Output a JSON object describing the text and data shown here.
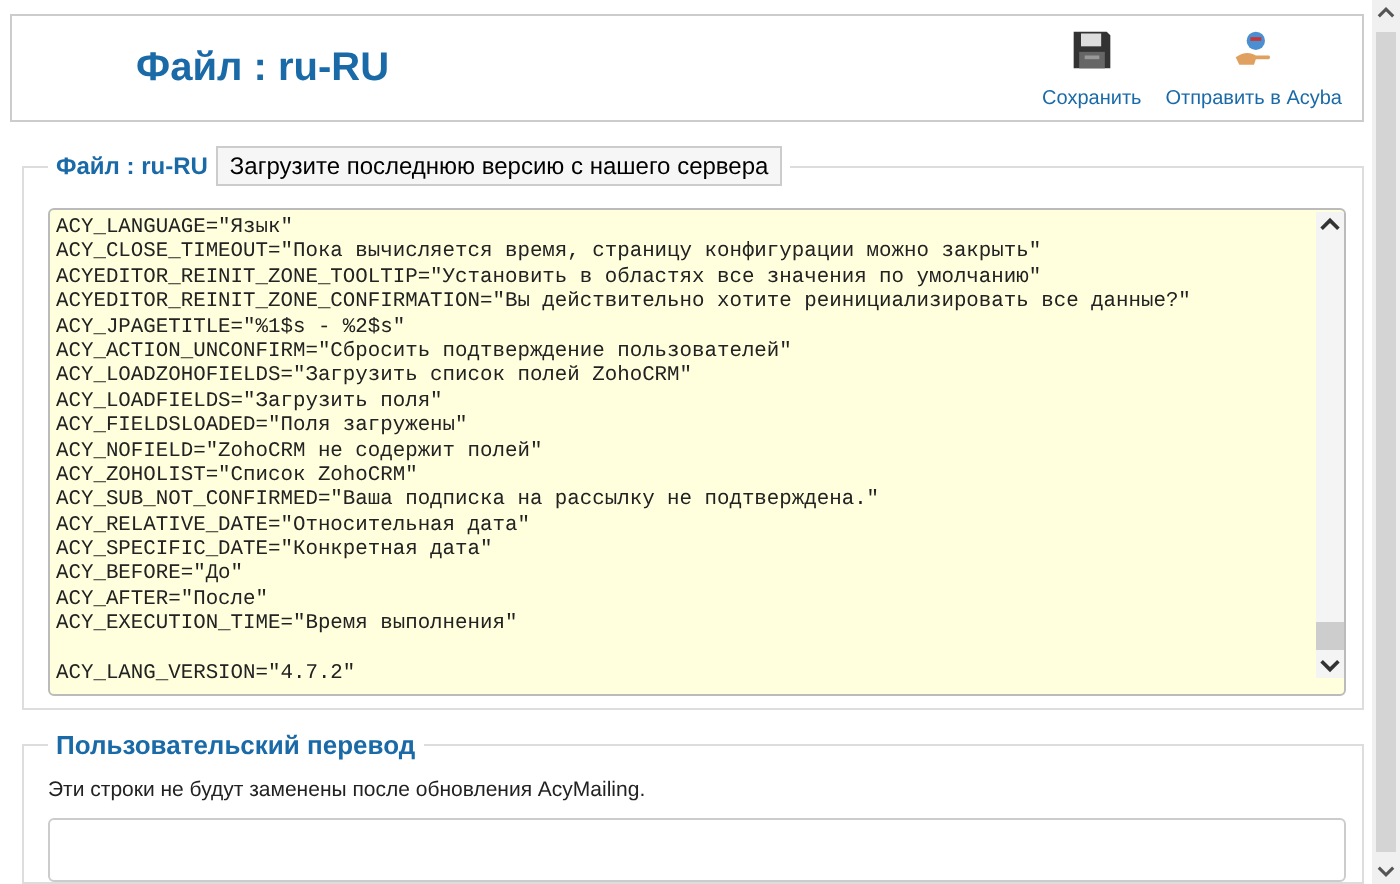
{
  "header": {
    "title": "Файл : ru-RU",
    "toolbar": [
      {
        "kind": "save",
        "label": "Сохранить"
      },
      {
        "kind": "send",
        "label": "Отправить в Acyba"
      }
    ]
  },
  "file_section": {
    "legend": "Файл : ru-RU",
    "download_button": "Загрузите последнюю версию с нашего сервера",
    "lines": [
      {
        "text": "ACY_LANGUAGE=\"Язык\""
      },
      {
        "text": "ACY_CLOSE_TIMEOUT=\"Пока вычисляется время, страницу конфигурации можно закрыть\""
      },
      {
        "text": "ACYEDITOR_REINIT_ZONE_TOOLTIP=\"Установить в областях все значения по умолчанию\""
      },
      {
        "text": "ACYEDITOR_REINIT_ZONE_CONFIRMATION=\"Вы действительно хотите реинициализировать все данные?\""
      },
      {
        "text": "ACY_JPAGETITLE=\"%1$s - %2$s\""
      },
      {
        "text": "ACY_ACTION_UNCONFIRM=\"Сбросить подтверждение пользователей\""
      },
      {
        "text": "ACY_LOADZOHOFIELDS=\"Загрузить список полей ZohoCRM\""
      },
      {
        "text": "ACY_LOADFIELDS=\"Загрузить поля\""
      },
      {
        "text": "ACY_FIELDSLOADED=\"Поля загружены\""
      },
      {
        "text": "ACY_NOFIELD=\"ZohoCRM не содержит полей\""
      },
      {
        "text": "ACY_ZOHOLIST=\"Список ZohoCRM\""
      },
      {
        "text": "ACY_SUB_NOT_CONFIRMED=\"Ваша подписка на рассылку не подтверждена.\""
      },
      {
        "text": "ACY_RELATIVE_DATE=\"Относительная дата\""
      },
      {
        "text": "ACY_SPECIFIC_DATE=\"Конкретная дата\""
      },
      {
        "text": "ACY_BEFORE=\"До\""
      },
      {
        "text": "ACY_AFTER=\"После\""
      },
      {
        "text": "ACY_EXECUTION_TIME=\"Время выполнения\""
      },
      {
        "text": "ACY_LANG_VERSION=\"4.7.2\"",
        "gap_before": true
      }
    ]
  },
  "custom_section": {
    "legend": "Пользовательский перевод",
    "note": "Эти строки не будут заменены после обновления AcyMailing."
  }
}
